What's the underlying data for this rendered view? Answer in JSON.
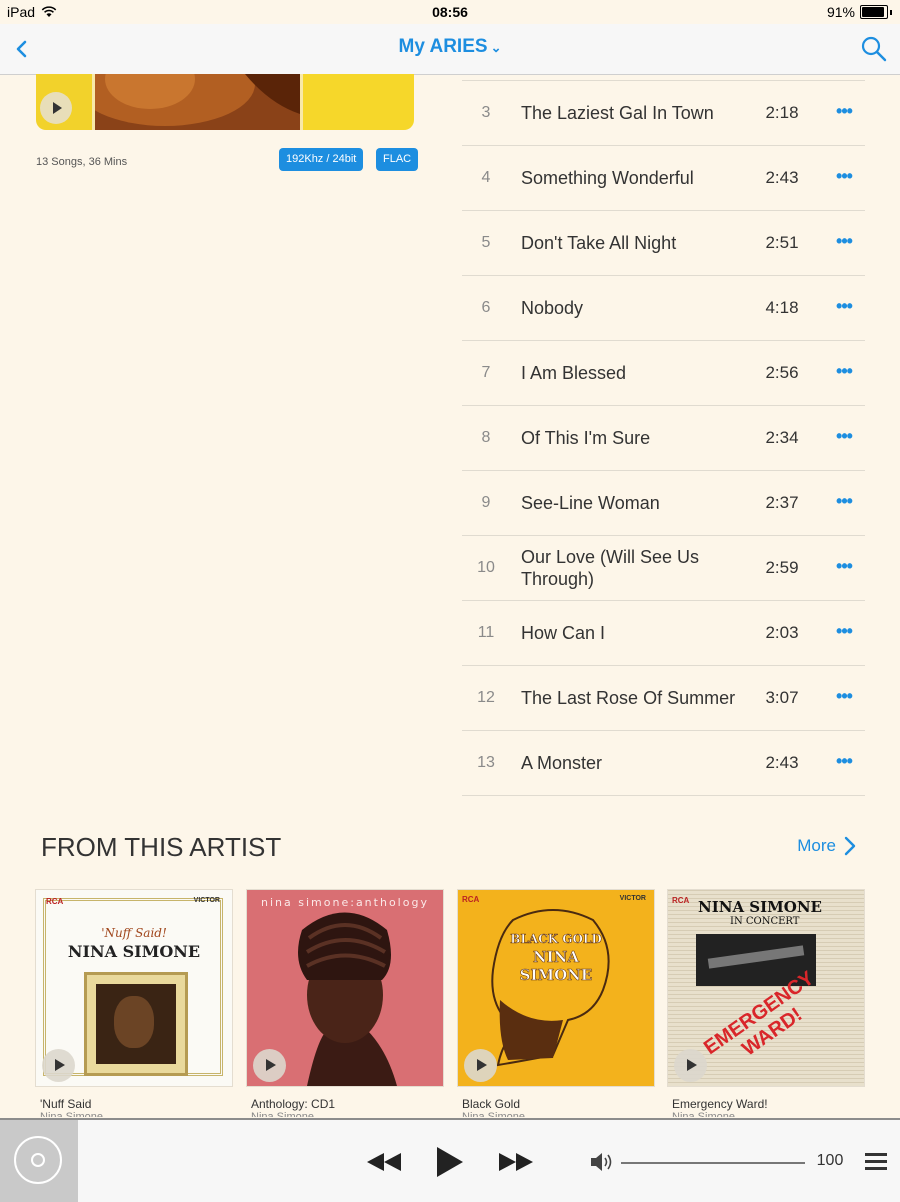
{
  "status_bar": {
    "device": "iPad",
    "time": "08:56",
    "battery": "91%",
    "battery_level": 0.91
  },
  "nav": {
    "title": "My ARIES"
  },
  "album": {
    "meta": "13 Songs, 36 Mins",
    "badges": [
      "192Khz / 24bit",
      "FLAC"
    ]
  },
  "tracks": [
    {
      "num": "3",
      "title": "The Laziest Gal In Town",
      "duration": "2:18"
    },
    {
      "num": "4",
      "title": "Something Wonderful",
      "duration": "2:43"
    },
    {
      "num": "5",
      "title": "Don't Take All Night",
      "duration": "2:51"
    },
    {
      "num": "6",
      "title": "Nobody",
      "duration": "4:18"
    },
    {
      "num": "7",
      "title": "I Am Blessed",
      "duration": "2:56"
    },
    {
      "num": "8",
      "title": "Of This I'm Sure",
      "duration": "2:34"
    },
    {
      "num": "9",
      "title": "See-Line Woman",
      "duration": "2:37"
    },
    {
      "num": "10",
      "title": "Our Love (Will See Us Through)",
      "duration": "2:59"
    },
    {
      "num": "11",
      "title": "How Can I",
      "duration": "2:03"
    },
    {
      "num": "12",
      "title": "The Last Rose Of Summer",
      "duration": "3:07"
    },
    {
      "num": "13",
      "title": "A Monster",
      "duration": "2:43"
    }
  ],
  "more_glyph": "•••",
  "artist_section": {
    "title": "FROM THIS ARTIST",
    "more": "More",
    "albums": [
      {
        "name": "'Nuff Said",
        "artist": "Nina Simone",
        "cover_text": [
          "'Nuff Said!",
          "NINA SIMONE"
        ],
        "label": [
          "RCA",
          "VICTOR"
        ]
      },
      {
        "name": "Anthology: CD1",
        "artist": "Nina Simone",
        "cover_text": [
          "nina simone:anthology"
        ]
      },
      {
        "name": "Black Gold",
        "artist": "Nina Simone",
        "cover_text": [
          "BLACK GOLD",
          "NINA",
          "SIMONE"
        ],
        "label": [
          "RCA",
          "VICTOR"
        ]
      },
      {
        "name": "Emergency Ward!",
        "artist": "Nina Simone",
        "cover_text": [
          "NINA SIMONE",
          "IN CONCERT",
          "EMERGENCY WARD!"
        ],
        "label": [
          "RCA"
        ]
      }
    ]
  },
  "player": {
    "volume": "100",
    "volume_level": 1.0
  },
  "colors": {
    "accent": "#1d8ee0",
    "background": "#fdf6e9"
  }
}
